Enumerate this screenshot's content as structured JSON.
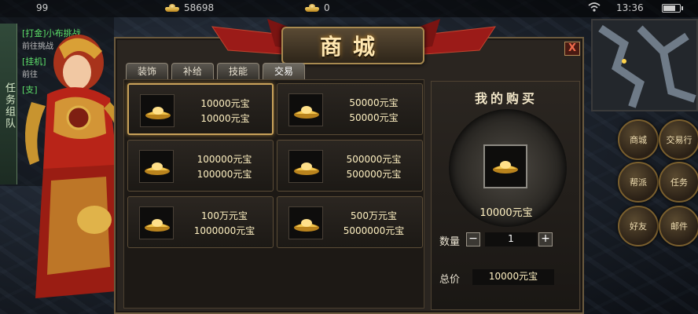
{
  "status_bar": {
    "currency1": "99",
    "currency2": "58698",
    "currency3": "0",
    "time": "13:36"
  },
  "quest_panel": {
    "tab_label": "任务组队",
    "items": [
      {
        "title": "[打金]小布挑战",
        "sub": "前往挑战"
      },
      {
        "title": "[挂机]",
        "sub": "前往"
      },
      {
        "title": "[支]",
        "sub": ""
      }
    ]
  },
  "shop": {
    "title": "商城",
    "close_label": "X",
    "tabs": [
      "装饰",
      "补给",
      "技能",
      "交易"
    ],
    "active_tab": 3,
    "items": [
      {
        "line1": "10000元宝",
        "line2": "10000元宝"
      },
      {
        "line1": "50000元宝",
        "line2": "50000元宝"
      },
      {
        "line1": "100000元宝",
        "line2": "100000元宝"
      },
      {
        "line1": "500000元宝",
        "line2": "500000元宝"
      },
      {
        "line1": "100万元宝",
        "line2": "1000000元宝"
      },
      {
        "line1": "500万元宝",
        "line2": "5000000元宝"
      }
    ],
    "selected_index": 0
  },
  "purchase": {
    "title": "我的购买",
    "item_name": "10000元宝",
    "qty_label": "数量",
    "minus_label": "−",
    "plus_label": "+",
    "quantity": "1",
    "price_label": "总价",
    "total": "10000元宝"
  },
  "side_buttons": [
    "商城",
    "交易行",
    "帮派",
    "任务",
    "好友",
    "邮件"
  ],
  "colors": {
    "accent_gold": "#c9a25a",
    "quest_green": "#5ee46b",
    "text_cream": "#fff1c2"
  }
}
